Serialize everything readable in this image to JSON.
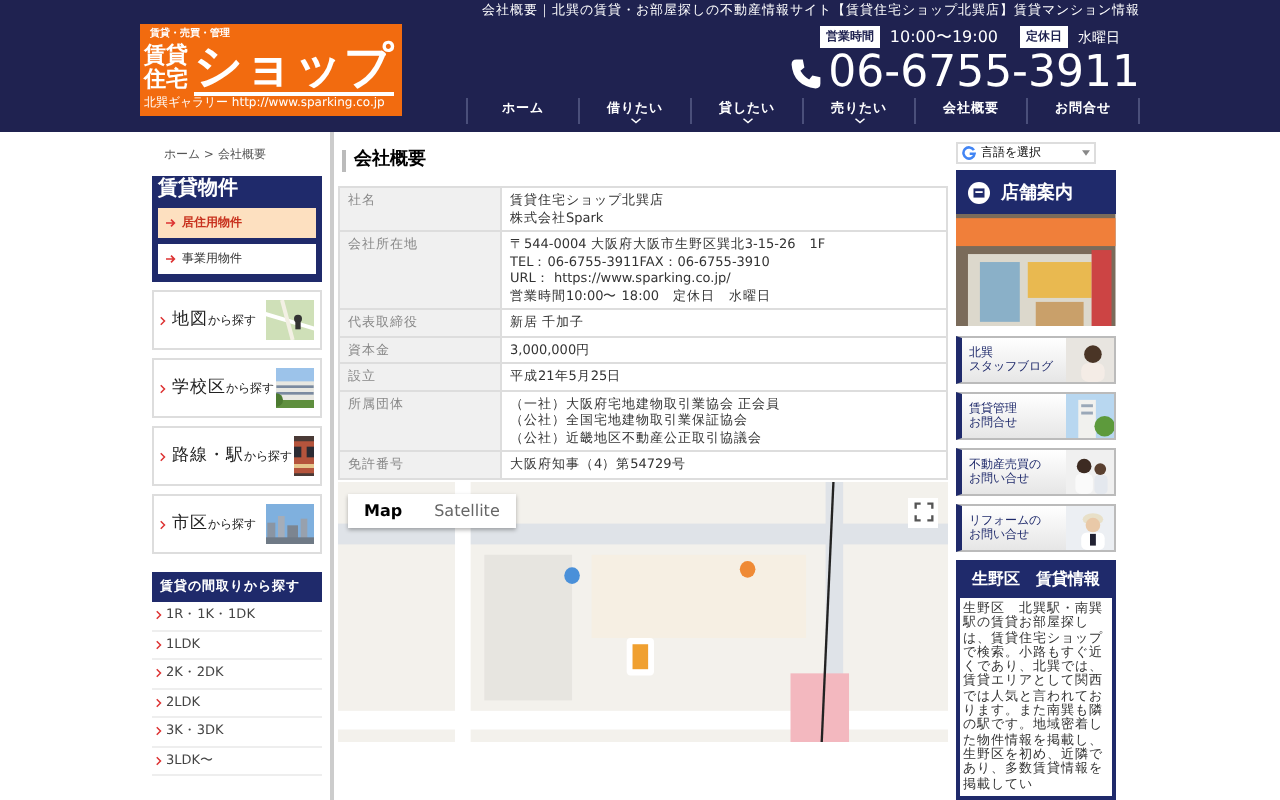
{
  "header": {
    "top_text": "会社概要｜北巽の賃貸・お部屋探しの不動産情報サイト【賃貸住宅ショップ北巽店】賃貸マンション情報",
    "logo": {
      "small": "賃貸・売買・管理",
      "line1": "賃貸",
      "line2": "住宅",
      "name": "ショップ",
      "caption": "北巽ギャラリー http://www.sparking.co.jp"
    },
    "hours_label": "営業時間",
    "hours": "10:00〜19:00",
    "holiday_label": "定休日",
    "holiday": "水曜日",
    "phone": "06-6755-3911"
  },
  "nav": [
    {
      "label": "ホーム",
      "has_submenu": false
    },
    {
      "label": "借りたい",
      "has_submenu": true
    },
    {
      "label": "貸したい",
      "has_submenu": true
    },
    {
      "label": "売りたい",
      "has_submenu": true
    },
    {
      "label": "会社概要",
      "has_submenu": false
    },
    {
      "label": "お問合せ",
      "has_submenu": false
    }
  ],
  "breadcrumb": "ホーム > 会社概要",
  "left": {
    "rental": {
      "title": "賃貸物件",
      "items": [
        {
          "label": "居住用物件",
          "selected": true
        },
        {
          "label": "事業用物件",
          "selected": false
        }
      ]
    },
    "search_cards": [
      {
        "label": "地図",
        "suffix": "から探す"
      },
      {
        "label": "学校区",
        "suffix": "から探す"
      },
      {
        "label": "路線・駅",
        "suffix": "から探す"
      },
      {
        "label": "市区",
        "suffix": "から探す"
      }
    ],
    "layouts": {
      "title": "賃貸の間取りから探す",
      "items": [
        "1R・1K・1DK",
        "1LDK",
        "2K・2DK",
        "2LDK",
        "3K・3DK",
        "3LDK〜"
      ]
    }
  },
  "content": {
    "title": "会社概要",
    "rows": [
      {
        "label": "社名",
        "lines": [
          "賃貸住宅ショップ北巽店",
          "株式会社Spark"
        ]
      },
      {
        "label": "会社所在地",
        "lines": [
          "〒544-0004 大阪府大阪市生野区巽北3-15-26　1F",
          "TEL：06-6755-3911FAX：06-6755-3910",
          "URL： https://www.sparking.co.jp/",
          "営業時間10:00〜 18:00　定休日　水曜日"
        ]
      },
      {
        "label": "代表取締役",
        "lines": [
          "新居 千加子"
        ]
      },
      {
        "label": "資本金",
        "lines": [
          "3,000,000円"
        ]
      },
      {
        "label": "設立",
        "lines": [
          "平成21年5月25日"
        ]
      },
      {
        "label": "所属団体",
        "lines": [
          "（一社）大阪府宅地建物取引業協会 正会員",
          "（公社）全国宅地建物取引業保証協会",
          "（公社）近畿地区不動産公正取引協議会"
        ]
      },
      {
        "label": "免許番号",
        "lines": [
          "大阪府知事（4）第54729号"
        ]
      }
    ],
    "map": {
      "tabs": [
        {
          "label": "Map",
          "selected": true
        },
        {
          "label": "Satellite",
          "selected": false
        }
      ]
    }
  },
  "right": {
    "translate": "言語を選択",
    "store_title": "店舗案内",
    "banners": [
      {
        "lines": [
          "北巽",
          "スタッフブログ"
        ]
      },
      {
        "lines": [
          "賃貸管理",
          "お問合せ"
        ]
      },
      {
        "lines": [
          "不動産売買の",
          "お問い合せ"
        ]
      },
      {
        "lines": [
          "リフォームの",
          "お問い合せ"
        ]
      }
    ],
    "info": {
      "title": "生野区　賃貸情報",
      "text": "生野区　北巽駅・南巽駅の賃貸お部屋探しは、賃貸住宅ショップで検索。小路もすぐ近くであり、北巽では、賃貸エリアとして関西では人気と言われております。また南巽も隣の駅です。地域密着した物件情報を掲載し、生野区を初め、近隣であり、多数賃貸情報を掲載してい"
    }
  }
}
